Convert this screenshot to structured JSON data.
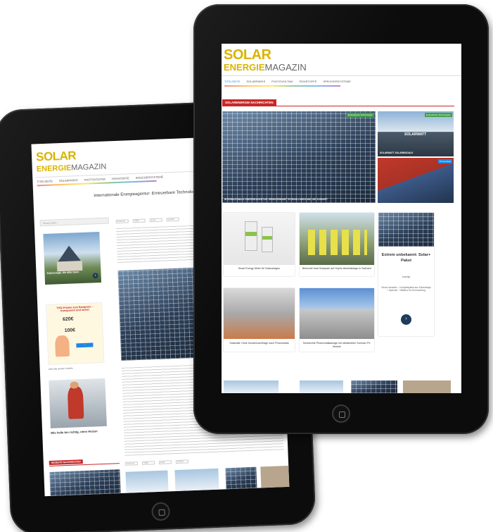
{
  "logo": {
    "line1": "SOLAR",
    "line2a": "ENERGIE",
    "line2b": "MAGAZIN"
  },
  "nav": [
    "Titelseite",
    "Solarparks",
    "Photovoltaik",
    "Rohstoffe",
    "Speichersysteme"
  ],
  "back": {
    "headline": "Internationale Energieagentur: Erneuerbare Technologien",
    "search_placeholder": "Search Here ...",
    "ad1_text": "Solaranlage, die alles kann",
    "ad2_title": "THG-Prämie zum Bestpreis – transparent und sicher",
    "ad2_price": "620€",
    "ad2_price2": "100€",
    "ad2_caption": "Jetzt alle grünen Vorteile",
    "ad3_caption": "Wie helle bin richtig, ohne Heizen",
    "latest_header": "NEUESTE NACHRICHTEN",
    "share": [
      "Facebook",
      "Twitter",
      "Email",
      "Linkedin"
    ]
  },
  "front": {
    "section_header": "SOLARENERGIE NACHRICHTEN",
    "hero_badge": "Erneuerbare Technologien",
    "hero_caption": "Internationale Energieagentur: Erneuerbare Technologien und die Zukunft",
    "side1_badge": "Erneuerbare Technologien",
    "side1_caption": "Solarwatt Solarmodule",
    "side1_logo": "SOLARWATT",
    "side2_badge": "Photovoltaik",
    "cards": [
      {
        "caption": "Smart Energy Meter für Solaranlagen"
      },
      {
        "caption": "Bietochte baut Solarpark auf Hoyhe-Abstellanlage in Sachsen"
      },
      {
        "caption": "Solarwatt: Hohe Kundennachfrage nach Photovoltaik"
      },
      {
        "caption": "Senkrechte Photovoltaikanlage mit ultraleichten Sunman PV-Module"
      }
    ],
    "ad_title": "Extrem unbekannt: Solar+ Paket",
    "ad_label": "Anzeige",
    "ad_sub": "Smart unkaufen – Komplettpaket aus Solaranlage + Speicher + Wallbox für 0€ Anzahlung",
    "ad_button": "›"
  }
}
